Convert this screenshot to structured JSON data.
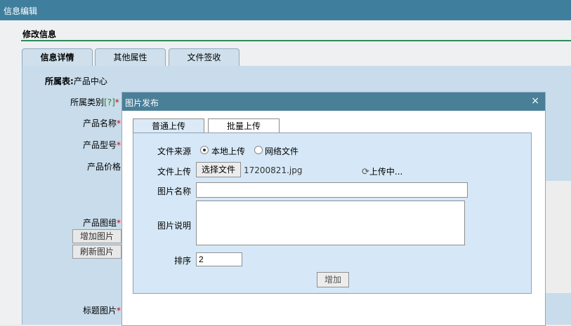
{
  "window": {
    "title": "信息编辑"
  },
  "form": {
    "section_title": "修改信息",
    "tabs": [
      "信息详情",
      "其他属性",
      "文件签收"
    ],
    "table_label": "所属表:",
    "table_value": "产品中心",
    "category_label": "所属类别",
    "category_help": "[?]",
    "name_label": "产品名称",
    "model_label": "产品型号",
    "price_label": "产品价格",
    "gallery_label": "产品图组",
    "add_image_button": "增加图片",
    "refresh_image_button": "刷新图片",
    "title_image_label": "标题图片",
    "required_mark": "*"
  },
  "dialog": {
    "title": "图片发布",
    "close_glyph": "×",
    "tabs": [
      "普通上传",
      "批量上传"
    ],
    "source_label": "文件来源",
    "source_options": [
      "本地上传",
      "网络文件"
    ],
    "source_selected": "本地上传",
    "upload_label": "文件上传",
    "choose_file_button": "选择文件",
    "chosen_file": "17200821.jpg",
    "upload_status": "上传中...",
    "image_name_label": "图片名称",
    "image_name_value": "",
    "image_desc_label": "图片说明",
    "image_desc_value": "",
    "sort_label": "排序",
    "sort_value": "2",
    "add_button": "增加"
  },
  "colors": {
    "titlebar": "#3f7f9d",
    "dialog_header": "#4a7f98",
    "required": "#dd0000",
    "divider": "#2e8b57"
  }
}
